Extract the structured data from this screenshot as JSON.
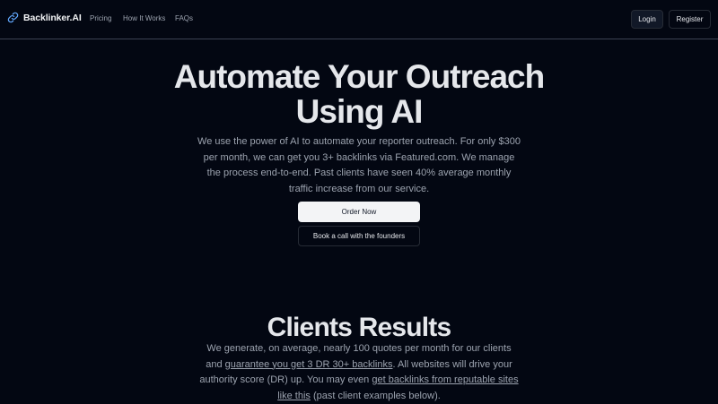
{
  "nav": {
    "brand": "Backlinker.AI",
    "brand_icon": "link-icon",
    "links": [
      "Pricing",
      "How It Works",
      "FAQs"
    ],
    "login_label": "Login",
    "register_label": "Register"
  },
  "hero": {
    "title_line1": "Automate Your Outreach",
    "title_line2": "Using AI",
    "subtitle": "We use the power of AI to automate your reporter outreach. For only $300 per month, we can get you 3+ backlinks via Featured.com. We manage the process end-to-end. Past clients have seen 40% average monthly traffic increase from our service.",
    "order_label": "Order Now",
    "book_label": "Book a call with the founders"
  },
  "clients": {
    "title": "Clients Results",
    "text_1": "We generate, on average, nearly 100 quotes per month for our clients and ",
    "link_1": "guarantee you get 3 DR 30+ backlinks",
    "text_2": ". All websites will drive your authority score (DR) up. You may even ",
    "link_2": "get backlinks from reputable sites like this",
    "text_3": " (past client examples below)."
  },
  "colors": {
    "background": "#030712",
    "text_primary": "#e5e7eb",
    "text_muted": "#9ca3af",
    "accent_icon": "#60a5fa"
  }
}
